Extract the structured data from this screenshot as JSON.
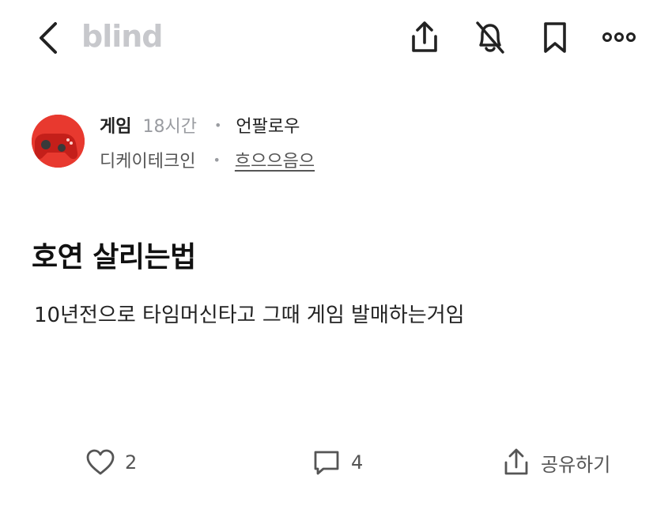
{
  "header": {
    "logo": "blind",
    "icons": [
      "back-icon",
      "share-icon",
      "bell-off-icon",
      "bookmark-icon",
      "more-icon"
    ]
  },
  "post": {
    "board": "게임",
    "time": "18시간",
    "separator": "•",
    "follow_label": "언팔로우",
    "company": "디케이테크인",
    "nickname": "흐으으음으",
    "title": "호연 살리는법",
    "body": "10년전으로 타임머신타고 그때 게임 발매하는거임"
  },
  "actions": {
    "like_count": "2",
    "comment_count": "4",
    "share_label": "공유하기"
  },
  "colors": {
    "logo": "#c7c8cc",
    "avatar_bg": "#e8392f",
    "muted_text": "#9a9ca1"
  }
}
